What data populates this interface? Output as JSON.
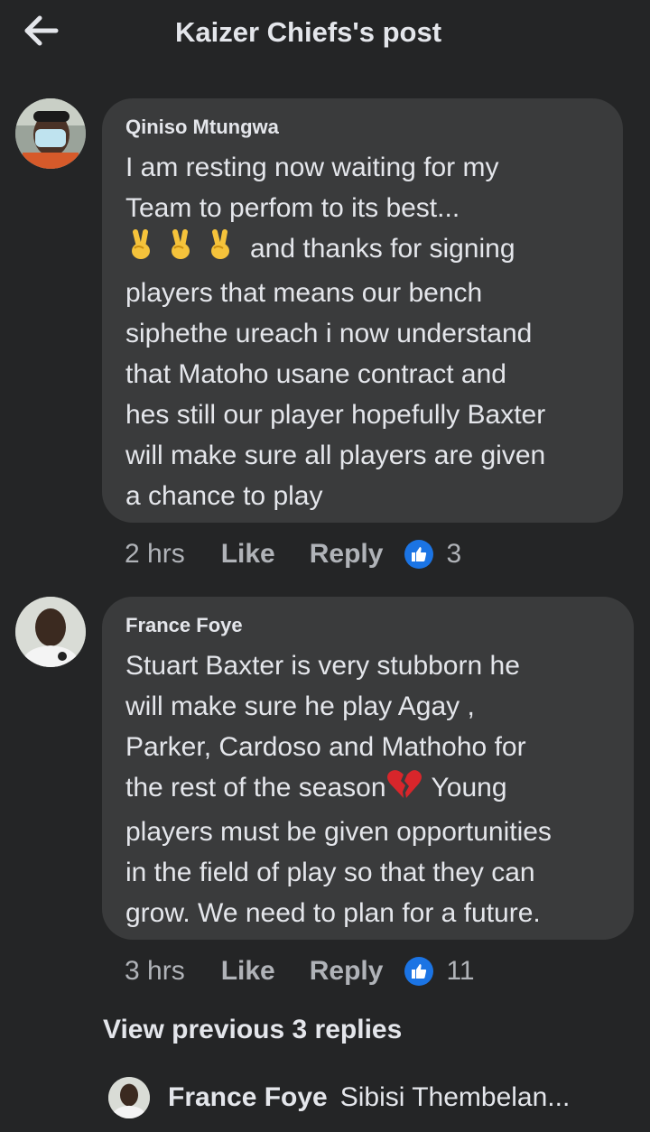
{
  "header": {
    "title": "Kaizer Chiefs's post"
  },
  "comments": [
    {
      "author": "Qiniso Mtungwa",
      "text_lines": [
        "I am resting now waiting for my",
        "Team to perfom to its best...",
        "and thanks for signing",
        "players that means our bench",
        "siphethe ureach i now understand",
        "that Matoho usane contract and",
        "hes still our player hopefully Baxter",
        "will make sure all players are given",
        "a chance to play"
      ],
      "time": "2 hrs",
      "like_label": "Like",
      "reply_label": "Reply",
      "reaction_count": "3"
    },
    {
      "author": "France Foye",
      "text_lines": [
        "Stuart Baxter is very stubborn he",
        "will make sure he play Agay ,",
        "Parker, Cardoso and Mathoho for",
        "the rest of the season",
        "Young",
        "players must be given opportunities",
        "in the field of play so that they can",
        "grow. We need to plan for a future."
      ],
      "time": "3 hrs",
      "like_label": "Like",
      "reply_label": "Reply",
      "reaction_count": "11"
    }
  ],
  "view_previous": "View previous 3 replies",
  "reply_preview": {
    "author": "France Foye",
    "text": "Sibisi Thembelan..."
  },
  "colors": {
    "background": "#242526",
    "bubble": "#3a3b3c",
    "like_blue": "#1b74e4",
    "meta_text": "#b0b3b8"
  },
  "icons": [
    "back-arrow-icon",
    "victory-hand-emoji",
    "broken-heart-emoji",
    "thumbs-up-icon"
  ]
}
